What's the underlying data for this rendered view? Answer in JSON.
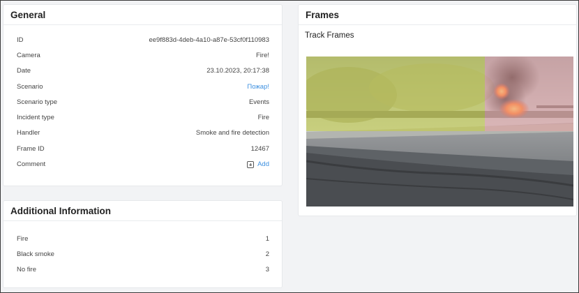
{
  "general": {
    "title": "General",
    "rows": [
      {
        "label": "ID",
        "value": "ee9f883d-4deb-4a10-a87e-53cf0f110983"
      },
      {
        "label": "Camera",
        "value": "Fire!"
      },
      {
        "label": "Date",
        "value": "23.10.2023, 20:17:38"
      },
      {
        "label": "Scenario",
        "value": "Пожар!"
      },
      {
        "label": "Scenario type",
        "value": "Events"
      },
      {
        "label": "Incident type",
        "value": "Fire"
      },
      {
        "label": "Handler",
        "value": "Smoke and fire detection"
      },
      {
        "label": "Frame ID",
        "value": "12467"
      }
    ],
    "comment_label": "Comment",
    "add_label": "Add"
  },
  "additional": {
    "title": "Additional Information",
    "rows": [
      {
        "label": "Fire",
        "value": "1"
      },
      {
        "label": "Black smoke",
        "value": "2"
      },
      {
        "label": "No fire",
        "value": "3"
      }
    ]
  },
  "frames": {
    "title": "Frames",
    "subtitle": "Track Frames"
  },
  "colors": {
    "link": "#3b8fe0",
    "smoke_overlay": "#c8cf3a",
    "fire_overlay": "#e9a3a3"
  },
  "icons": {
    "add": "plus-square-icon"
  }
}
